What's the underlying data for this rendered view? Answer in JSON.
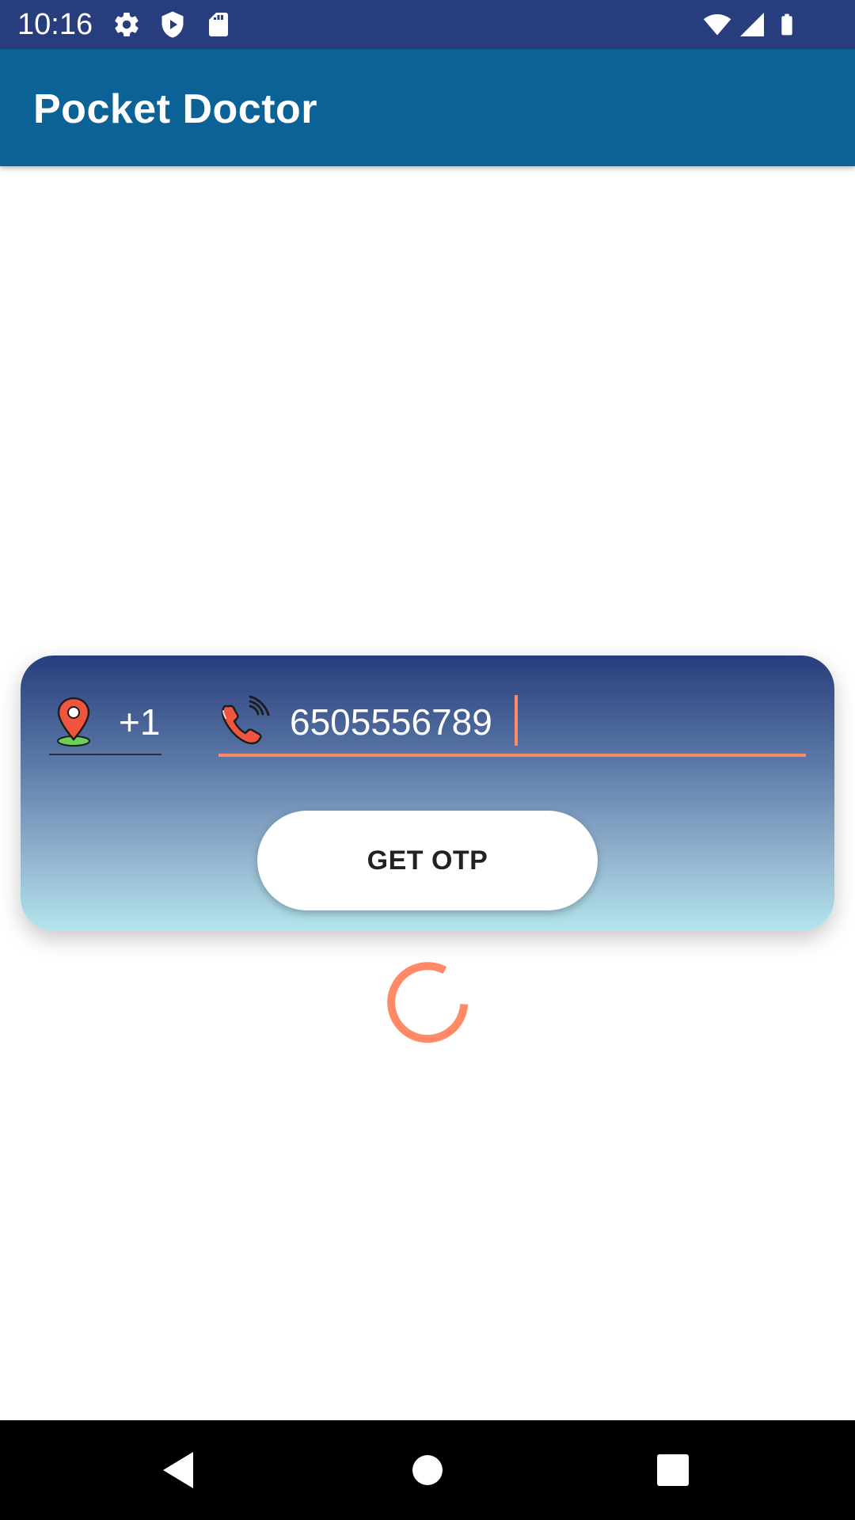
{
  "status_bar": {
    "time": "10:16",
    "background": "#283d7d",
    "icons": [
      "gear-icon",
      "shield-icon",
      "sd-card-icon",
      "wifi-icon",
      "cellular-signal-icon",
      "battery-icon"
    ]
  },
  "app_bar": {
    "title": "Pocket Doctor",
    "background": "#0b6296"
  },
  "login_card": {
    "country_code": "+1",
    "country_icon": "location-pin-icon",
    "phone_icon": "phone-call-icon",
    "phone_number": "6505556789",
    "accent": "#ff8a65",
    "get_otp_label": "GET OTP"
  },
  "progress": {
    "icon": "loading-spinner-icon",
    "color": "#ff8a65"
  },
  "nav_bar": {
    "icons": [
      "back-icon",
      "home-icon",
      "overview-icon"
    ]
  }
}
